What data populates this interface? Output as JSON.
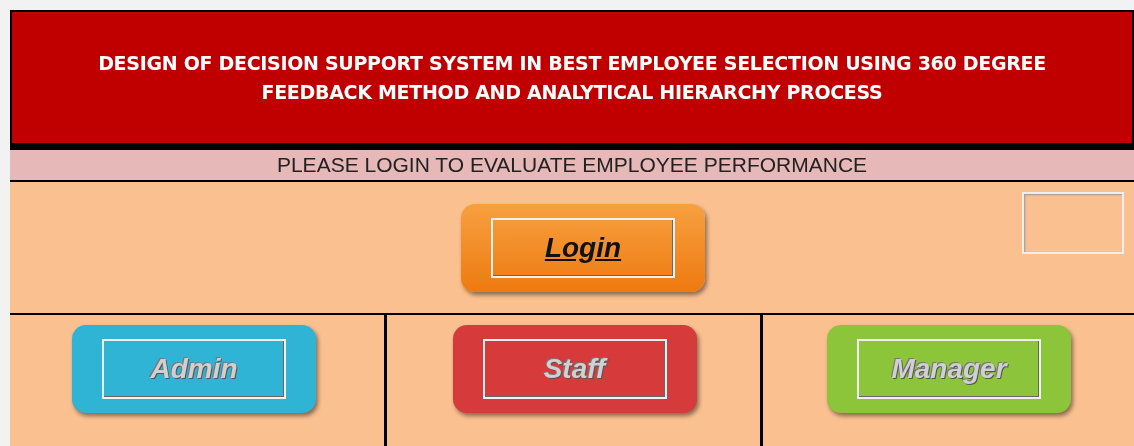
{
  "header": {
    "title": "DESIGN OF DECISION SUPPORT SYSTEM IN BEST EMPLOYEE SELECTION  USING 360 DEGREE FEEDBACK METHOD AND ANALYTICAL HIERARCHY PROCESS"
  },
  "notice": "PLEASE LOGIN TO EVALUATE EMPLOYEE PERFORMANCE",
  "login": {
    "label": "Login",
    "disabled": false
  },
  "roles": [
    {
      "label": "Admin",
      "color": "#2fb4d6",
      "disabled": true
    },
    {
      "label": "Staff",
      "color": "#d63a3a",
      "disabled": true
    },
    {
      "label": "Manager",
      "color": "#8cc43a",
      "disabled": true
    }
  ]
}
